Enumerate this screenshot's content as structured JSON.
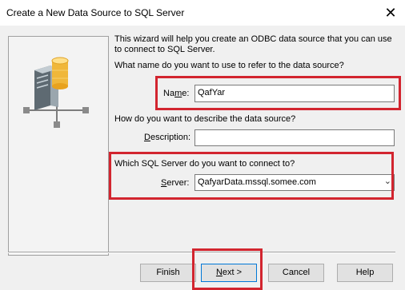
{
  "window": {
    "title": "Create a New Data Source to SQL Server",
    "close_glyph": "✕"
  },
  "intro": "This wizard will help you create an ODBC data source that you can use to connect to SQL Server.",
  "name_section": {
    "question": "What name do you want to use to refer to the data source?",
    "label_prefix": "Na",
    "label_mnemonic": "m",
    "label_suffix": "e:",
    "value": "QafYar"
  },
  "description_section": {
    "question": "How do you want to describe the data source?",
    "label_mnemonic": "D",
    "label_suffix": "escription:",
    "value": ""
  },
  "server_section": {
    "question": "Which SQL Server do you want to connect to?",
    "label_mnemonic": "S",
    "label_suffix": "erver:",
    "value": "QafyarData.mssql.somee.com"
  },
  "buttons": {
    "finish": "Finish",
    "next_mnemonic": "N",
    "next_rest": "ext >",
    "cancel": "Cancel",
    "help": "Help"
  },
  "colors": {
    "highlight": "#d2252f",
    "dialog_bg": "#f0f0f0"
  },
  "icons": {
    "wizard_graphic": "database-server-icon",
    "dropdown": "chevron-down-icon",
    "close": "close-icon"
  }
}
